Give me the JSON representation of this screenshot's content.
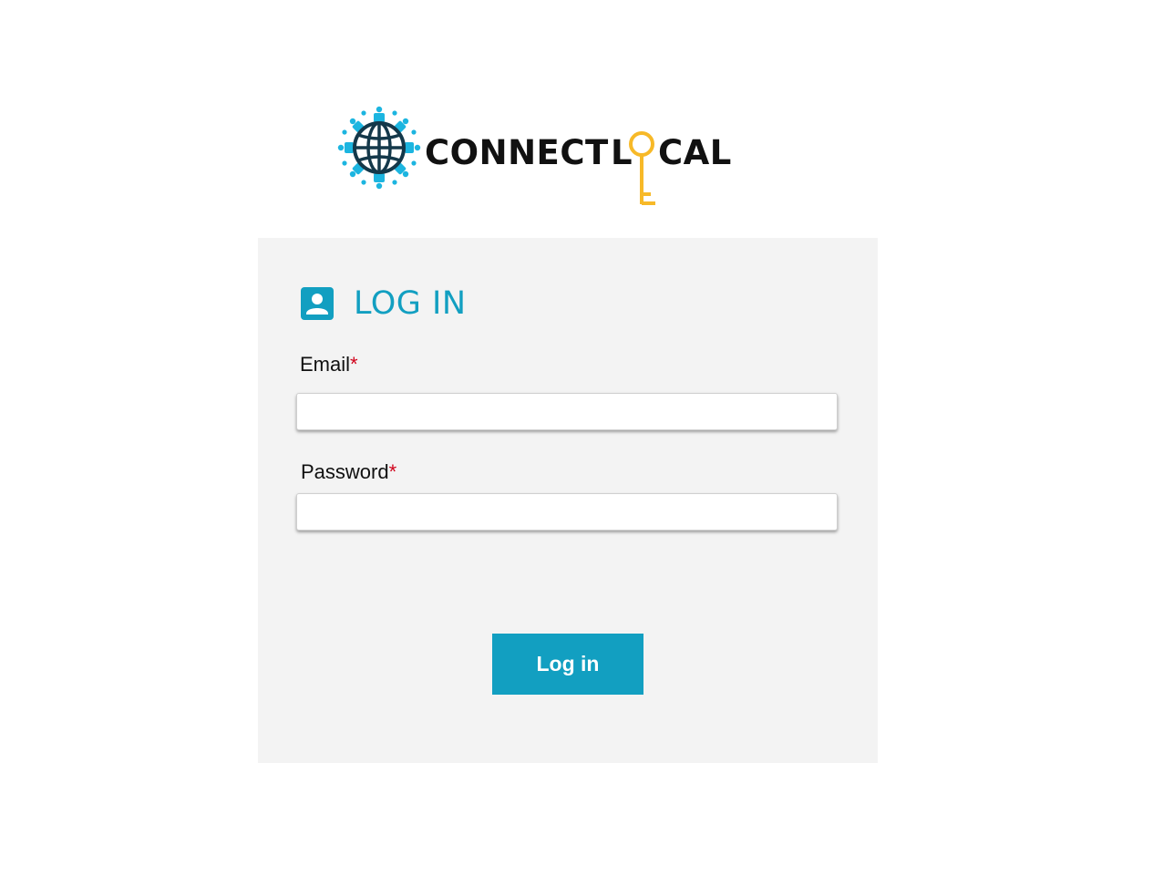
{
  "logo": {
    "text_connect": "CONNECT",
    "text_l": "L",
    "text_cal": "CAL",
    "globe_color": "#1cb5e0",
    "globe_line_color": "#14384a",
    "key_color": "#f7b928"
  },
  "login": {
    "title": "LOG IN",
    "title_color": "#129fc1",
    "email_label": "Email",
    "password_label": "Password",
    "required_marker": "*",
    "email_value": "",
    "password_value": "",
    "submit_label": "Log in"
  },
  "icons": {
    "heading_icon": "account-box-icon",
    "logo_globe": "globe-icon",
    "logo_key": "key-icon"
  }
}
